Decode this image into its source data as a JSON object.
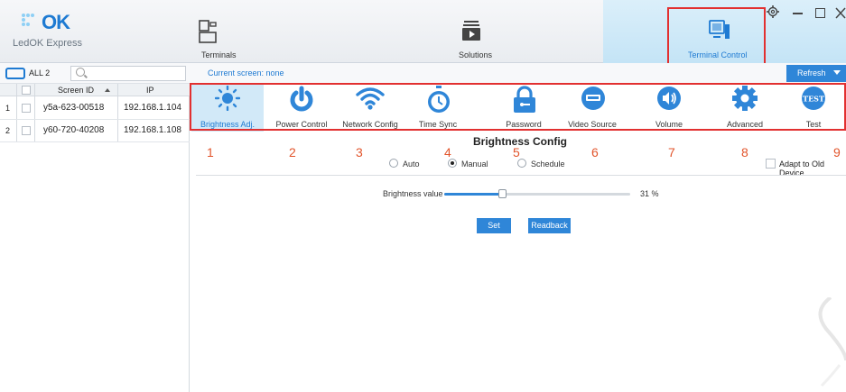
{
  "app": {
    "logo_mark": "OK",
    "logo_name": "LedOK Express"
  },
  "nav": {
    "tabs": [
      {
        "label": "Terminals"
      },
      {
        "label": "Solutions"
      },
      {
        "label": "Terminal Control"
      }
    ]
  },
  "toolbar": {
    "all_label": "ALL 2",
    "search_placeholder": "",
    "current_screen": "Current screen: none",
    "refresh_label": "Refresh"
  },
  "table": {
    "columns": [
      "Screen ID",
      "IP"
    ],
    "rows": [
      {
        "index": "1",
        "screen_id": "y5a-623-00518",
        "ip": "192.168.1.104"
      },
      {
        "index": "2",
        "screen_id": "y60-720-40208",
        "ip": "192.168.1.108"
      }
    ]
  },
  "features": [
    {
      "label": "Brightness Adj.",
      "icon": "sun-icon",
      "active": true
    },
    {
      "label": "Power Control",
      "icon": "power-icon"
    },
    {
      "label": "Network Config",
      "icon": "wifi-icon"
    },
    {
      "label": "Time Sync",
      "icon": "clock-icon"
    },
    {
      "label": "Password",
      "icon": "lock-icon"
    },
    {
      "label": "Video Source",
      "icon": "video-source-icon"
    },
    {
      "label": "Volume",
      "icon": "speaker-icon"
    },
    {
      "label": "Advanced",
      "icon": "gear-icon"
    },
    {
      "label": "Test",
      "icon": "test-badge-icon"
    }
  ],
  "annotations": [
    "1",
    "2",
    "3",
    "4",
    "5",
    "6",
    "7",
    "8",
    "9"
  ],
  "brightness": {
    "title": "Brightness Config",
    "modes": [
      {
        "label": "Auto",
        "selected": false
      },
      {
        "label": "Manual",
        "selected": true
      },
      {
        "label": "Schedule",
        "selected": false
      }
    ],
    "adapt_label": "Adapt to Old Device",
    "adapt_checked": false,
    "value_label": "Brightness value",
    "value": 31,
    "value_text": "31 %",
    "set_label": "Set",
    "readback_label": "Readback"
  },
  "colors": {
    "accent": "#2f86d8",
    "active_tab": "#d2e9f8",
    "annotation_red": "#e23030",
    "annotation_number": "#e2552c"
  }
}
